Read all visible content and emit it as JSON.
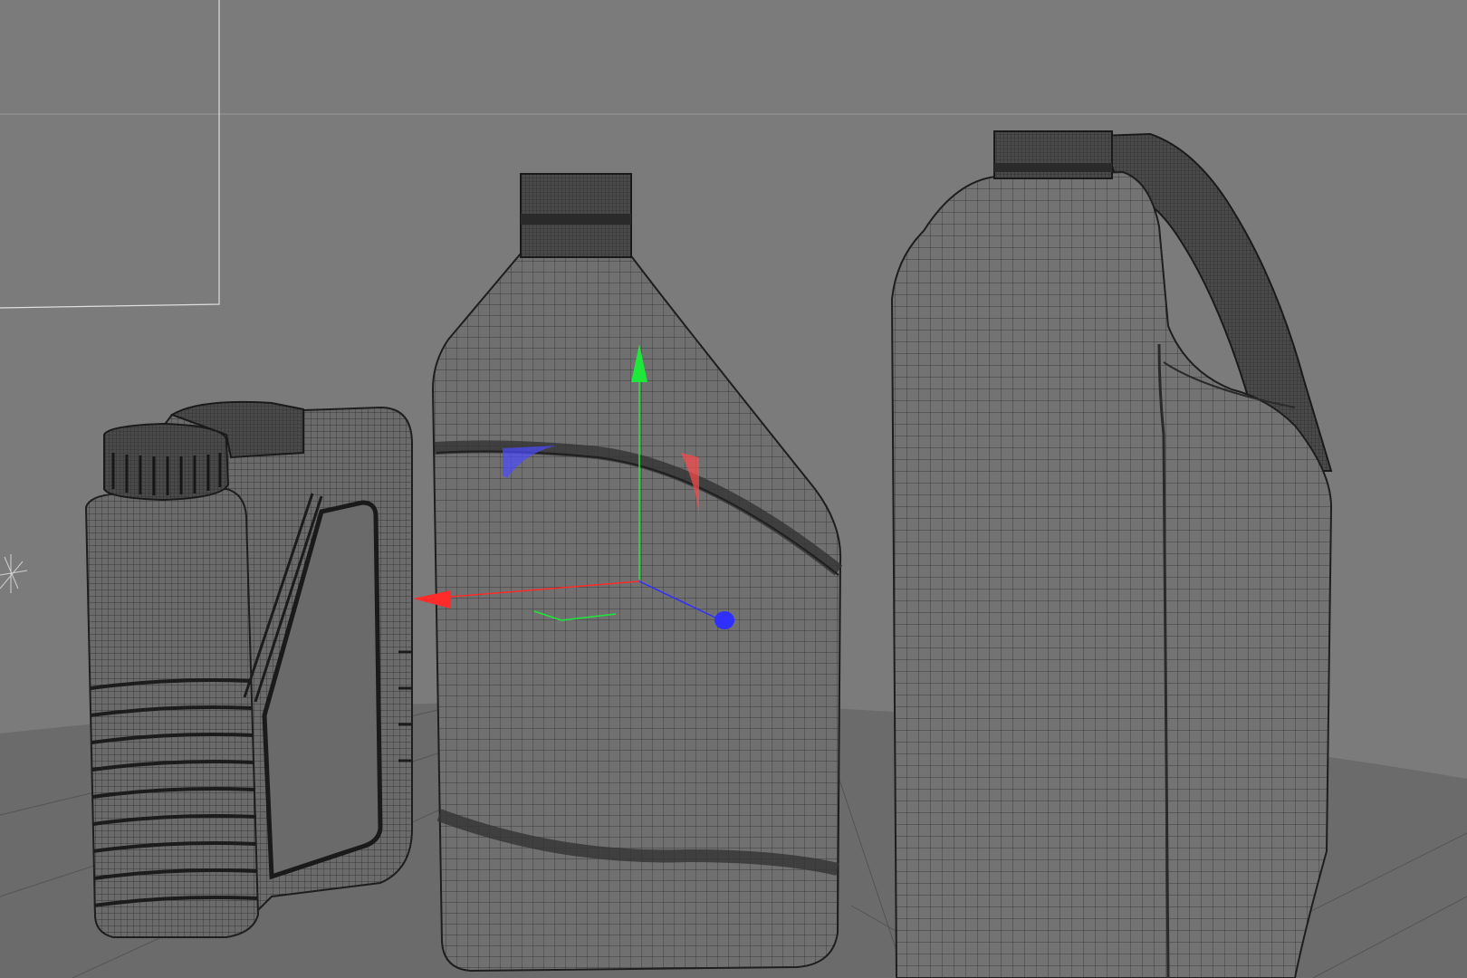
{
  "viewport": {
    "background_color": "#7b7b7b",
    "floor_color": "#6a6a6a",
    "horizon_line_color": "#9a9a9a",
    "camera_frame_color": "#d8d8d8",
    "objects": [
      {
        "name": "small-oil-canister",
        "wire_color": "#262626",
        "fill_color": "#6e6e6e"
      },
      {
        "name": "center-oil-bottle",
        "wire_color": "#262626",
        "fill_color": "#727272",
        "selected": true
      },
      {
        "name": "large-jerrycan",
        "wire_color": "#262626",
        "fill_color": "#757575"
      }
    ],
    "transform_gizmo": {
      "x_axis_color": "#ff2a2a",
      "y_axis_color": "#1ee83a",
      "z_axis_color": "#2f2fff"
    }
  }
}
